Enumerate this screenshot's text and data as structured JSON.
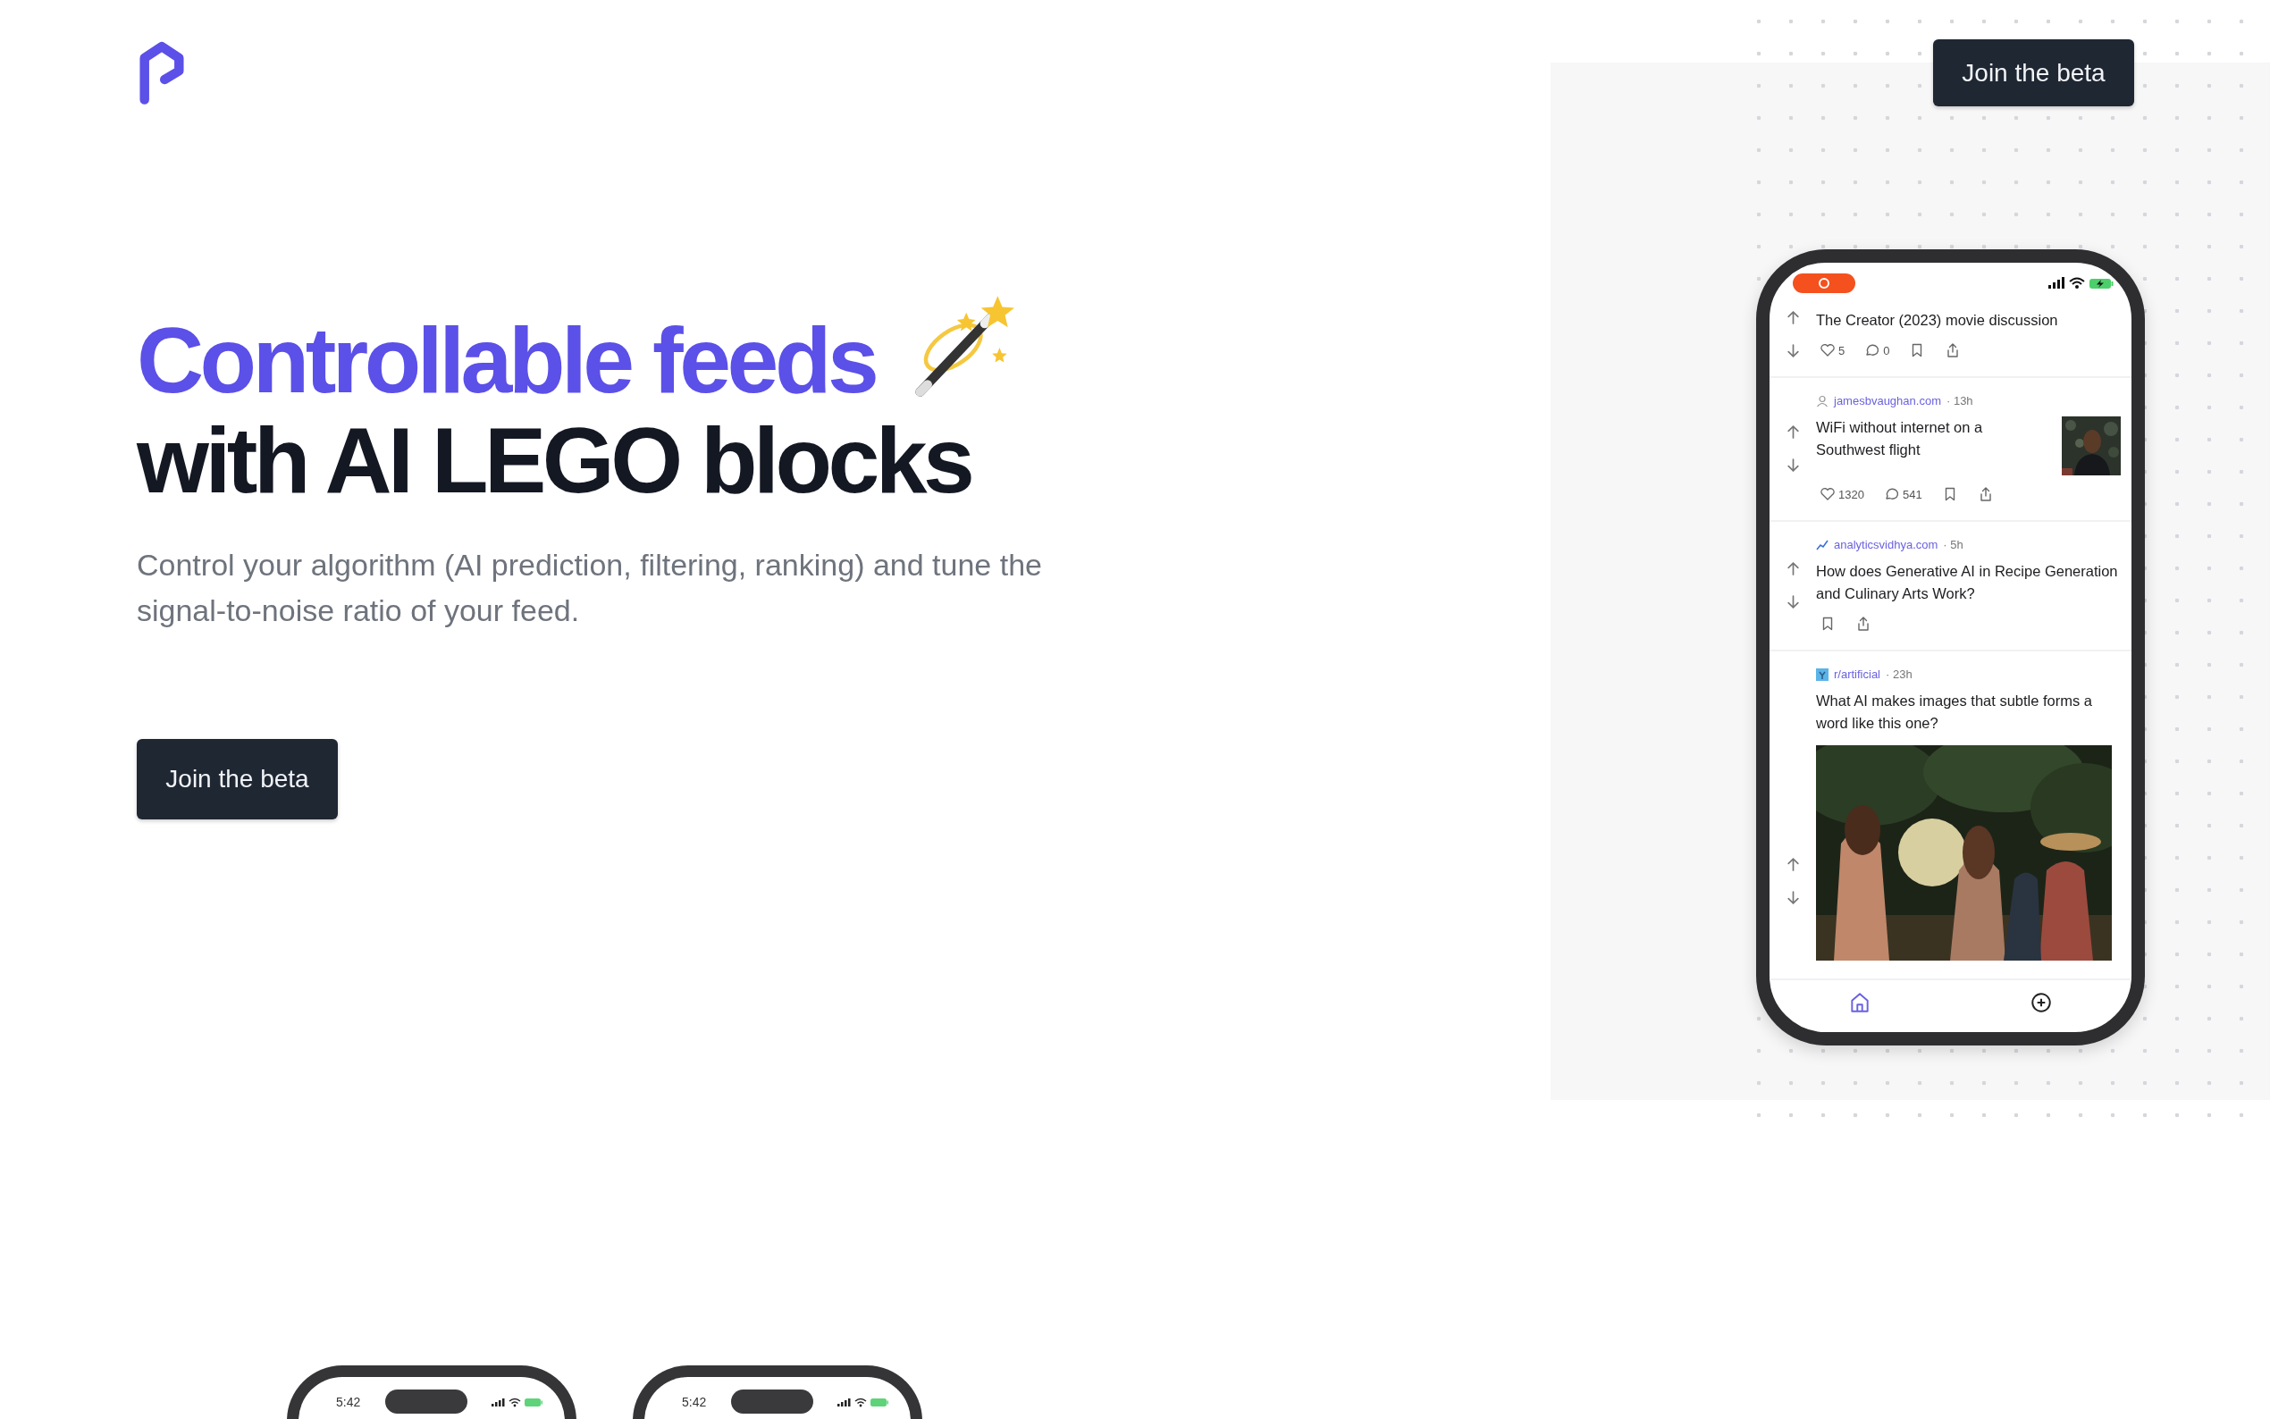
{
  "nav": {
    "cta": "Join the beta"
  },
  "hero": {
    "title_highlight": "Controllable feeds",
    "title_rest": "with AI LEGO blocks",
    "subtitle": "Control your algorithm (AI prediction, filtering, ranking) and tune the signal-to-noise ratio of your feed.",
    "cta": "Join the beta"
  },
  "phone": {
    "posts": [
      {
        "kind": "text",
        "title": "The Creator (2023) movie discussion",
        "likes": "5",
        "comments": "0"
      },
      {
        "kind": "thumbnail",
        "source": "jamesbvaughan.com",
        "age": "· 13h",
        "title": "WiFi without internet on a Southwest flight",
        "likes": "1320",
        "comments": "541"
      },
      {
        "kind": "text",
        "source": "analyticsvidhya.com",
        "age": "· 5h",
        "title": "How does Generative AI in Recipe Generation and Culinary Arts Work?"
      },
      {
        "source": "r/artificial",
        "age": "· 23h",
        "title": "What AI makes images that subtle forms a word like this one?"
      }
    ],
    "tabs": [
      {
        "kind": "home",
        "selected": true
      },
      {
        "kind": "add",
        "selected": false
      }
    ]
  },
  "preview_phones": [
    {
      "time": "5:42"
    },
    {
      "time": "5:42"
    }
  ]
}
